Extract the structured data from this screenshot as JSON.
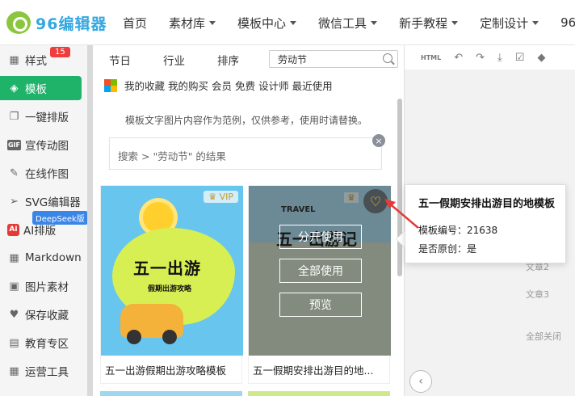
{
  "brand": {
    "logo_text": "96编辑器"
  },
  "topnav": [
    {
      "label": "首页",
      "has_caret": false
    },
    {
      "label": "素材库",
      "has_caret": true
    },
    {
      "label": "模板中心",
      "has_caret": true
    },
    {
      "label": "微信工具",
      "has_caret": true
    },
    {
      "label": "新手教程",
      "has_caret": true
    },
    {
      "label": "定制设计",
      "has_caret": true
    },
    {
      "label": "96",
      "has_caret": false
    }
  ],
  "sidebar": {
    "items": [
      {
        "label": "样式",
        "icon": "grid-icon"
      },
      {
        "label": "模板",
        "icon": "layers-icon"
      },
      {
        "label": "一键排版",
        "icon": "copy-icon"
      },
      {
        "label": "宣传动图",
        "icon": "gif-icon"
      },
      {
        "label": "在线作图",
        "icon": "edit-icon"
      },
      {
        "label": "SVG编辑器",
        "icon": "send-icon"
      },
      {
        "label": "AI排版",
        "icon": "ai-icon"
      },
      {
        "label": "Markdown",
        "icon": "grid-icon"
      },
      {
        "label": "图片素材",
        "icon": "image-icon"
      },
      {
        "label": "保存收藏",
        "icon": "heart-icon"
      },
      {
        "label": "教育专区",
        "icon": "book-icon"
      },
      {
        "label": "运营工具",
        "icon": "grid-icon"
      }
    ],
    "style_badge": "15",
    "deepseek_badge": "DeepSeek版"
  },
  "panel": {
    "tabs": [
      "节日",
      "行业",
      "排序"
    ],
    "search_value": "劳动节",
    "fav_links": [
      "我的收藏",
      "我的购买",
      "会员",
      "免费",
      "设计师",
      "最近使用"
    ],
    "notice": "模板文字图片内容作为范例，仅供参考，使用时请替换。",
    "result_prefix": "搜索",
    "result_text": "\"劳动节\" 的结果",
    "close_glyph": "×"
  },
  "cards": [
    {
      "title": "五一出游假期出游攻略模板",
      "thumb_title": "五一出游",
      "thumb_sub": "假期出游攻略",
      "vip_label": "VIP"
    },
    {
      "title": "五一假期安排出游目的地...",
      "thumb_travel": "TRAVEL",
      "thumb_title": "五一出游记",
      "overlay_buttons": [
        "分开使用",
        "全部使用",
        "预览"
      ]
    }
  ],
  "tooltip": {
    "title": "五一假期安排出游目的地模板",
    "id_label": "模板编号：21638",
    "original_label": "是否原创：是"
  },
  "right_panel": {
    "toolbar": [
      "HTML",
      "↶",
      "↷",
      "⤓",
      "☑",
      "◆"
    ],
    "labels": [
      "文章2",
      "文章3",
      "全部关闭"
    ],
    "prev_glyph": "‹"
  },
  "colors": {
    "accent_green": "#1fb36a",
    "badge_red": "#f03c3c",
    "badge_blue": "#3a86e8",
    "logo_blue": "#35a8e0"
  }
}
